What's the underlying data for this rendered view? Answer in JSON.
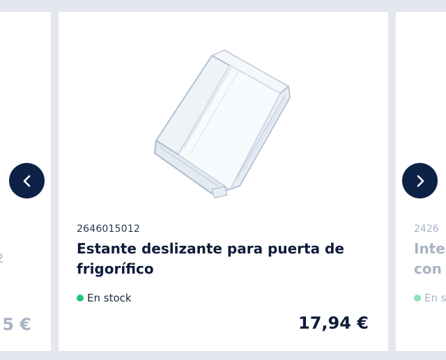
{
  "carousel": {
    "prev_label": "‹",
    "next_label": "›",
    "left_card": {
      "fragment": "2",
      "price": "5 €"
    },
    "main_card": {
      "sku": "2646015012",
      "title": "Estante deslizante para puerta de frigorífico",
      "stock": "En stock",
      "price": "17,94 €",
      "image_icon": "fridge-door-shelf-image"
    },
    "right_card": {
      "sku": "2426",
      "title_line1": "Inte",
      "title_line2": "con",
      "stock": "En s"
    }
  },
  "colors": {
    "accent": "#0d2146",
    "stock_dot": "#22c47b",
    "background": "#e4e8ee"
  }
}
